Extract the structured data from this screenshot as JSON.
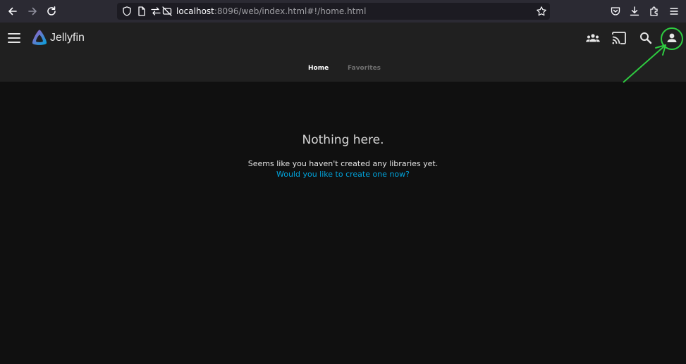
{
  "browser": {
    "url_host": "localhost",
    "url_path": ":8096/web/index.html#!/home.html",
    "icons": [
      "back-icon",
      "forward-icon",
      "reload-icon",
      "shield-icon",
      "page-icon",
      "permissions-icon",
      "tracking-protection-icon",
      "bookmark-star-icon",
      "pocket-icon",
      "downloads-icon",
      "extensions-icon",
      "menu-icon"
    ]
  },
  "header": {
    "app_name": "Jellyfin",
    "icons": [
      "menu-icon",
      "jellyfin-logo",
      "sync-play-icon",
      "cast-icon",
      "search-icon",
      "user-icon"
    ],
    "tabs": [
      {
        "label": "Home",
        "active": true
      },
      {
        "label": "Favorites",
        "active": false
      }
    ]
  },
  "main": {
    "empty_title": "Nothing here.",
    "empty_message": "Seems like you haven't created any libraries yet.",
    "create_link": "Would you like to create one now?"
  },
  "colors": {
    "accent": "#00a4dc",
    "annotation": "#2ecc40",
    "header_bg": "#202020",
    "page_bg": "#101010"
  }
}
